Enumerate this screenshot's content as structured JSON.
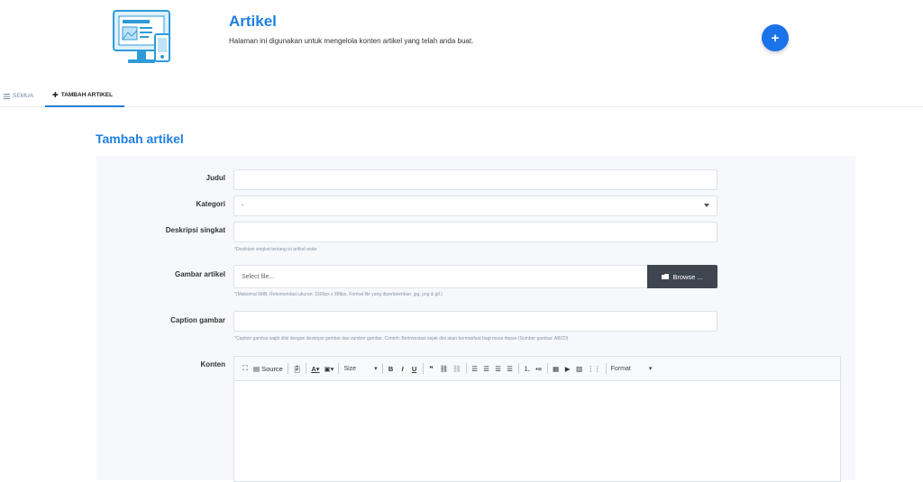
{
  "header": {
    "title": "Artikel",
    "description": "Halaman ini digunakan untuk mengelola konten artikel yang telah anda buat.",
    "fab_label": "+"
  },
  "tabs": [
    {
      "icon": "list-icon",
      "label": "SEMUA"
    },
    {
      "icon": "plus-icon",
      "label": "TAMBAH ARTIKEL"
    }
  ],
  "form": {
    "section_title": "Tambah artikel",
    "judul_label": "Judul",
    "kategori_label": "Kategori",
    "kategori_value": "-",
    "deskripsi_label": "Deskripsi singkat",
    "deskripsi_hint": "*Deskripsi singkat tentang isi artikel anda",
    "gambar_label": "Gambar artikel",
    "gambar_placeholder": "Select file...",
    "browse_label": "Browse ...",
    "gambar_hint": "*(Maksimal 5MB. Rekomendasi ukuran: 1500px x 998px. Format file yang diperbolehkan: jpg, png & gif.)",
    "caption_label": "Caption gambar",
    "caption_hint": "*Caption gambar wajib diisi dengan deskripsi gambar dan sumber gambar. Contoh: Berinvestasi sejak dini akan bermanfaat bagi masa depan (Sumber gambar: ABCD)",
    "konten_label": "Konten"
  },
  "editor_toolbar": {
    "source_label": "Source",
    "size_label": "Size",
    "format_label": "Format"
  },
  "colors": {
    "accent": "#1f7fe0",
    "fab": "#1a73e8",
    "browse_bg": "#3e4650",
    "panel_bg": "#f6f8fb"
  }
}
